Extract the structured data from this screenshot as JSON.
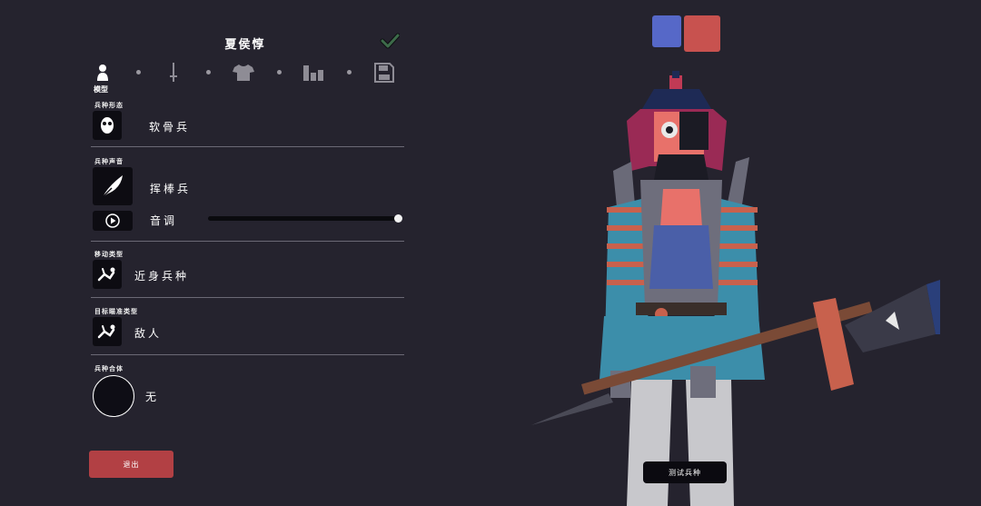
{
  "panel": {
    "title": "夏侯惇",
    "tabs": [
      {
        "name": "model",
        "icon": "person-icon",
        "label": "模型"
      },
      {
        "name": "weapon",
        "icon": "sword-icon"
      },
      {
        "name": "clothing",
        "icon": "shirt-icon"
      },
      {
        "name": "stats",
        "icon": "bar-chart-icon"
      },
      {
        "name": "save",
        "icon": "save-icon"
      }
    ]
  },
  "sections": {
    "form": {
      "label": "兵种形态",
      "value": "软骨兵"
    },
    "voice": {
      "label": "兵种声音",
      "value": "挥棒兵",
      "pitch_label": "音调",
      "pitch_level": 1.0
    },
    "movement": {
      "label": "移动类型",
      "value": "近身兵种"
    },
    "targeting": {
      "label": "目标瞄准类型",
      "value": "敌人"
    },
    "combine": {
      "label": "兵种合体",
      "value": "无"
    }
  },
  "buttons": {
    "exit": "退出",
    "test_unit": "测试兵种"
  },
  "team_colors": {
    "blue": "#5668c8",
    "red": "#c8524f"
  },
  "colors": {
    "background": "#25232e",
    "accent_red": "#b24044",
    "check_green": "#3d6b4a"
  }
}
